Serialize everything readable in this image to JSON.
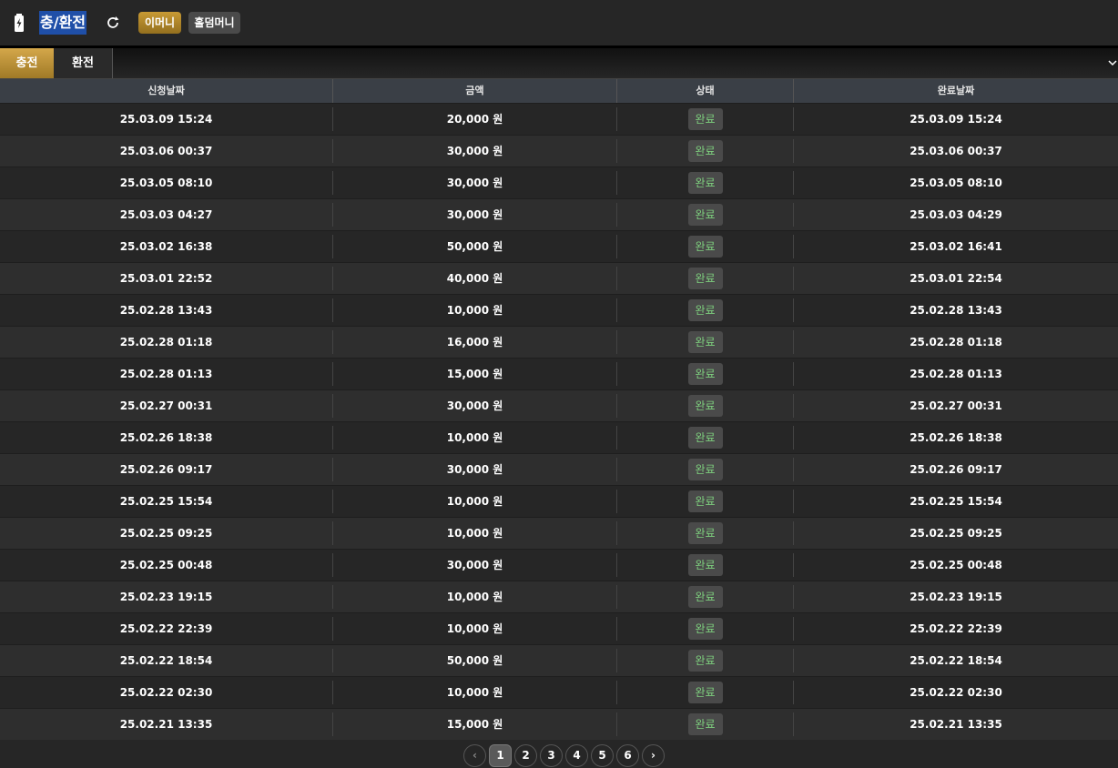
{
  "header": {
    "title": "충/환전",
    "emoney_label": "이머니",
    "holdem_label": "홀덤머니",
    "accent_color": "#c89a34"
  },
  "tabs": {
    "charge_label": "충전",
    "exchange_label": "환전",
    "active": "충전"
  },
  "table": {
    "headers": [
      "신청날짜",
      "금액",
      "상태",
      "완료날짜"
    ],
    "rows": [
      {
        "request_date": "25.03.09 15:24",
        "amount": "20,000 원",
        "status": "완료",
        "done_date": "25.03.09 15:24"
      },
      {
        "request_date": "25.03.06 00:37",
        "amount": "30,000 원",
        "status": "완료",
        "done_date": "25.03.06 00:37"
      },
      {
        "request_date": "25.03.05 08:10",
        "amount": "30,000 원",
        "status": "완료",
        "done_date": "25.03.05 08:10"
      },
      {
        "request_date": "25.03.03 04:27",
        "amount": "30,000 원",
        "status": "완료",
        "done_date": "25.03.03 04:29"
      },
      {
        "request_date": "25.03.02 16:38",
        "amount": "50,000 원",
        "status": "완료",
        "done_date": "25.03.02 16:41"
      },
      {
        "request_date": "25.03.01 22:52",
        "amount": "40,000 원",
        "status": "완료",
        "done_date": "25.03.01 22:54"
      },
      {
        "request_date": "25.02.28 13:43",
        "amount": "10,000 원",
        "status": "완료",
        "done_date": "25.02.28 13:43"
      },
      {
        "request_date": "25.02.28 01:18",
        "amount": "16,000 원",
        "status": "완료",
        "done_date": "25.02.28 01:18"
      },
      {
        "request_date": "25.02.28 01:13",
        "amount": "15,000 원",
        "status": "완료",
        "done_date": "25.02.28 01:13"
      },
      {
        "request_date": "25.02.27 00:31",
        "amount": "30,000 원",
        "status": "완료",
        "done_date": "25.02.27 00:31"
      },
      {
        "request_date": "25.02.26 18:38",
        "amount": "10,000 원",
        "status": "완료",
        "done_date": "25.02.26 18:38"
      },
      {
        "request_date": "25.02.26 09:17",
        "amount": "30,000 원",
        "status": "완료",
        "done_date": "25.02.26 09:17"
      },
      {
        "request_date": "25.02.25 15:54",
        "amount": "10,000 원",
        "status": "완료",
        "done_date": "25.02.25 15:54"
      },
      {
        "request_date": "25.02.25 09:25",
        "amount": "10,000 원",
        "status": "완료",
        "done_date": "25.02.25 09:25"
      },
      {
        "request_date": "25.02.25 00:48",
        "amount": "30,000 원",
        "status": "완료",
        "done_date": "25.02.25 00:48"
      },
      {
        "request_date": "25.02.23 19:15",
        "amount": "10,000 원",
        "status": "완료",
        "done_date": "25.02.23 19:15"
      },
      {
        "request_date": "25.02.22 22:39",
        "amount": "10,000 원",
        "status": "완료",
        "done_date": "25.02.22 22:39"
      },
      {
        "request_date": "25.02.22 18:54",
        "amount": "50,000 원",
        "status": "완료",
        "done_date": "25.02.22 18:54"
      },
      {
        "request_date": "25.02.22 02:30",
        "amount": "10,000 원",
        "status": "완료",
        "done_date": "25.02.22 02:30"
      },
      {
        "request_date": "25.02.21 13:35",
        "amount": "15,000 원",
        "status": "완료",
        "done_date": "25.02.21 13:35"
      }
    ]
  },
  "pagination": {
    "pages": [
      "1",
      "2",
      "3",
      "4",
      "5",
      "6"
    ],
    "current": "1",
    "prev_icon": "‹",
    "next_icon": "›"
  }
}
